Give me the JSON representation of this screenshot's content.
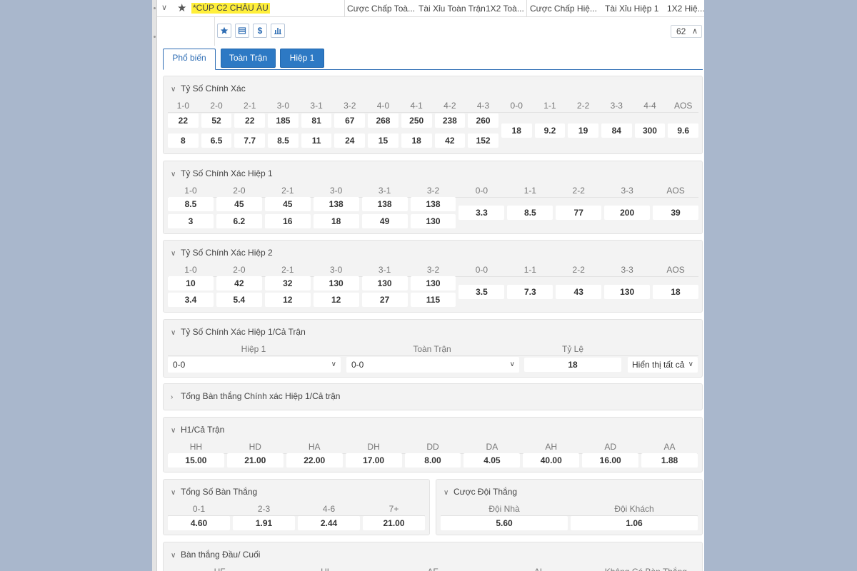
{
  "header": {
    "league": "*CÚP C2 CHÂU ÂU",
    "columns": [
      "Cược Chấp Toà...",
      "Tài Xỉu Toàn Trận",
      "1X2 Toà...",
      "Cược Chấp Hiệ...",
      "Tài Xỉu Hiệp 1",
      "1X2 Hiệ..."
    ]
  },
  "toolbar": {
    "count": "62"
  },
  "tabs": [
    "Phổ biến",
    "Toàn Trận",
    "Hiệp 1"
  ],
  "exact_score": {
    "title": "Tỷ Số Chính Xác",
    "labels": [
      "1-0",
      "2-0",
      "2-1",
      "3-0",
      "3-1",
      "3-2",
      "4-0",
      "4-1",
      "4-2",
      "4-3",
      "0-0",
      "1-1",
      "2-2",
      "3-3",
      "4-4",
      "AOS"
    ],
    "row1": [
      "22",
      "52",
      "22",
      "185",
      "81",
      "67",
      "268",
      "250",
      "238",
      "260"
    ],
    "row2": [
      "8",
      "6.5",
      "7.7",
      "8.5",
      "11",
      "24",
      "15",
      "18",
      "42",
      "152"
    ],
    "draws": [
      "18",
      "9.2",
      "19",
      "84",
      "300",
      "9.6"
    ]
  },
  "exact_h1": {
    "title": "Tỷ Số Chính Xác Hiệp 1",
    "labels": [
      "1-0",
      "2-0",
      "2-1",
      "3-0",
      "3-1",
      "3-2",
      "0-0",
      "1-1",
      "2-2",
      "3-3",
      "AOS"
    ],
    "row1": [
      "8.5",
      "45",
      "45",
      "138",
      "138",
      "138"
    ],
    "row2": [
      "3",
      "6.2",
      "16",
      "18",
      "49",
      "130"
    ],
    "draws": [
      "3.3",
      "8.5",
      "77",
      "200",
      "39"
    ]
  },
  "exact_h2": {
    "title": "Tỷ Số Chính Xác Hiệp 2",
    "labels": [
      "1-0",
      "2-0",
      "2-1",
      "3-0",
      "3-1",
      "3-2",
      "0-0",
      "1-1",
      "2-2",
      "3-3",
      "AOS"
    ],
    "row1": [
      "10",
      "42",
      "32",
      "130",
      "130",
      "130"
    ],
    "row2": [
      "3.4",
      "5.4",
      "12",
      "12",
      "27",
      "115"
    ],
    "draws": [
      "3.5",
      "7.3",
      "43",
      "130",
      "18"
    ]
  },
  "ht_ft_exact": {
    "title": "Tỷ Số Chính Xác Hiệp 1/Cả Trận",
    "col_h1": "Hiệp 1",
    "col_ft": "Toàn Trận",
    "col_odds": "Tỷ Lệ",
    "h1_value": "0-0",
    "ft_value": "0-0",
    "odds_value": "18",
    "show_all": "Hiển thị tất cả"
  },
  "total_goals_exact": {
    "title": "Tổng Bàn thắng Chính xác Hiệp 1/Cả trận"
  },
  "h1_ft": {
    "title": "H1/Cả Trận",
    "labels": [
      "HH",
      "HD",
      "HA",
      "DH",
      "DD",
      "DA",
      "AH",
      "AD",
      "AA"
    ],
    "values": [
      "15.00",
      "21.00",
      "22.00",
      "17.00",
      "8.00",
      "4.05",
      "40.00",
      "16.00",
      "1.88"
    ]
  },
  "total_goals": {
    "title": "Tổng Số Bàn Thắng",
    "labels": [
      "0-1",
      "2-3",
      "4-6",
      "7+"
    ],
    "values": [
      "4.60",
      "1.91",
      "2.44",
      "21.00"
    ]
  },
  "winner": {
    "title": "Cược Đội Thắng",
    "labels": [
      "Đội Nhà",
      "Đội Khách"
    ],
    "values": [
      "5.60",
      "1.06"
    ]
  },
  "first_last": {
    "title": "Bàn thắng Đầu/ Cuối",
    "labels": [
      "HF",
      "HL",
      "AF",
      "AL",
      "Không Có Bàn Thắng"
    ]
  }
}
